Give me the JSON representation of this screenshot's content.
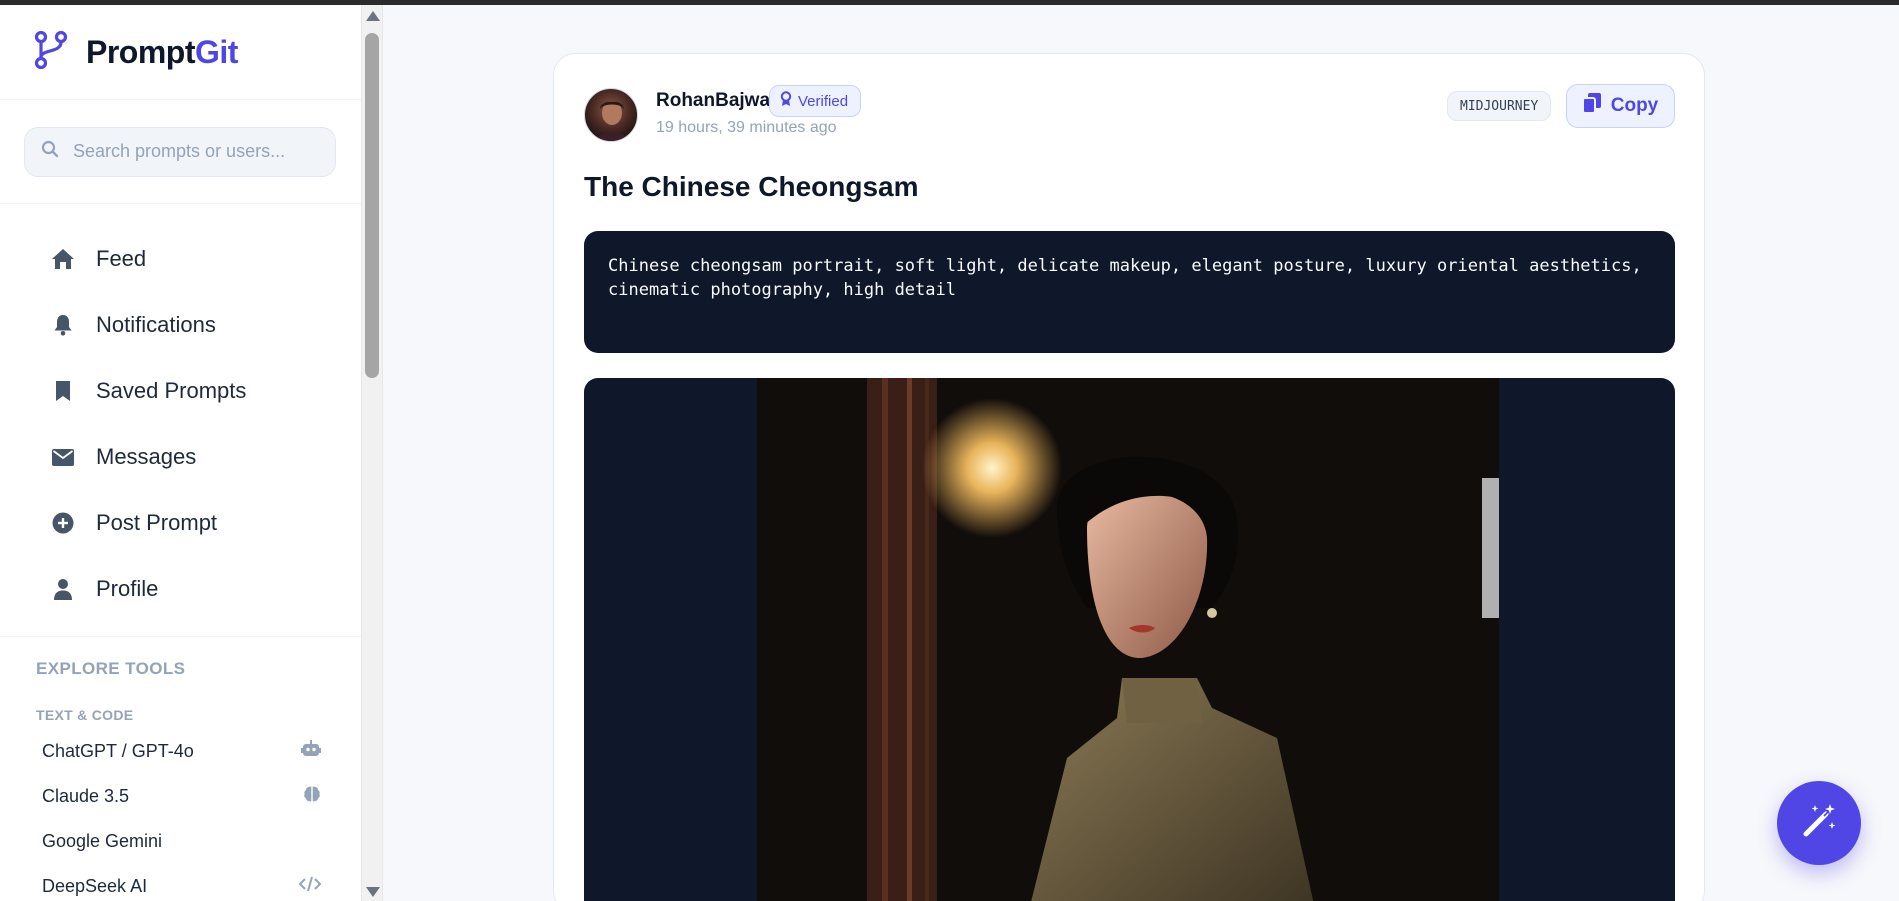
{
  "brand": {
    "name_part1": "Prompt",
    "name_part2": "Git",
    "accent": "#4f46e5"
  },
  "search": {
    "placeholder": "Search prompts or users...",
    "value": ""
  },
  "nav": [
    {
      "label": "Feed",
      "icon": "home-icon"
    },
    {
      "label": "Notifications",
      "icon": "bell-icon"
    },
    {
      "label": "Saved Prompts",
      "icon": "bookmark-icon"
    },
    {
      "label": "Messages",
      "icon": "envelope-icon"
    },
    {
      "label": "Post Prompt",
      "icon": "plus-circle-icon"
    },
    {
      "label": "Profile",
      "icon": "user-icon"
    }
  ],
  "explore": {
    "heading": "EXPLORE TOOLS",
    "subheading": "TEXT & CODE",
    "tools": [
      {
        "label": "ChatGPT / GPT-4o",
        "icon": "robot-icon"
      },
      {
        "label": "Claude 3.5",
        "icon": "brain-icon"
      },
      {
        "label": "Google Gemini",
        "icon": ""
      },
      {
        "label": "DeepSeek AI",
        "icon": "code-icon"
      }
    ]
  },
  "post": {
    "username": "RohanBajwa",
    "verified_label": "Verified",
    "time": "19 hours, 39 minutes ago",
    "model_badge": "MIDJOURNEY",
    "copy_label": "Copy",
    "title": "The Chinese Cheongsam",
    "prompt_line1": "Chinese cheongsam portrait, soft light, delicate makeup, elegant posture, luxury oriental aesthetics,",
    "prompt_line2": "cinematic photography, high detail"
  },
  "fab": {
    "icon": "magic-wand-icon"
  }
}
